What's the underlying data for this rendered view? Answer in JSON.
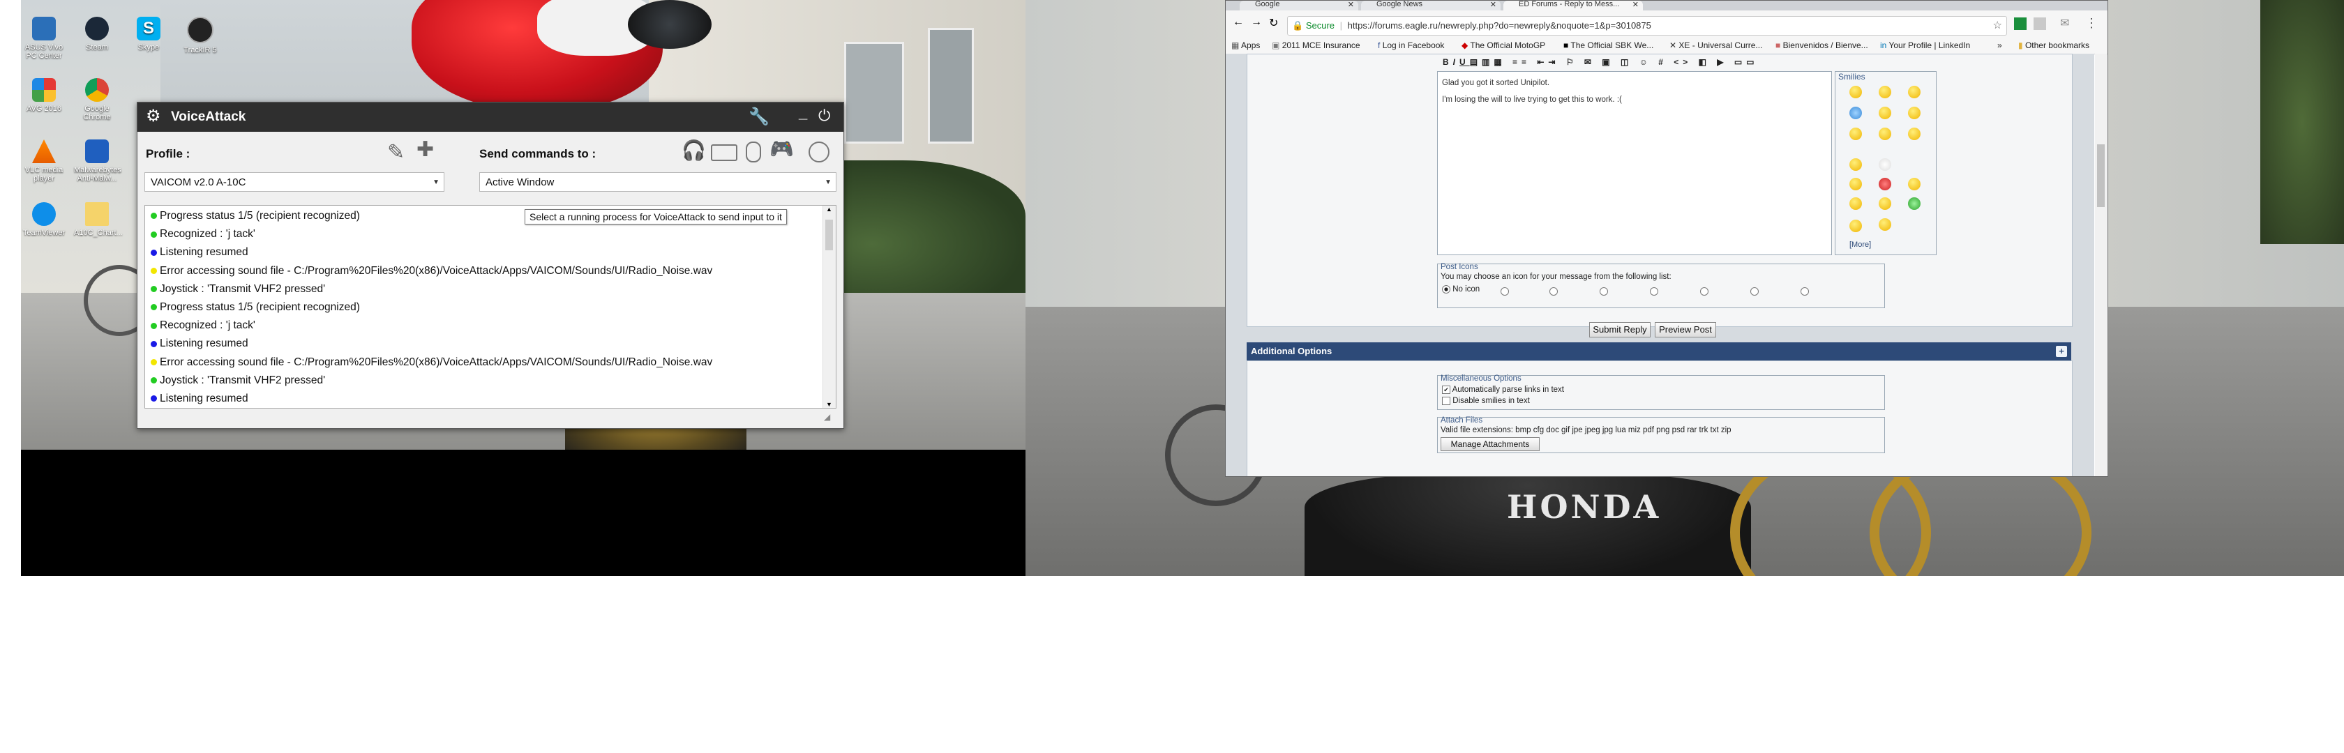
{
  "desktop_icons": [
    {
      "label": "ASUS Vivo PC Center",
      "icon": "asus-icon"
    },
    {
      "label": "Steam",
      "icon": "steam-icon"
    },
    {
      "label": "Skype",
      "icon": "skype-icon"
    },
    {
      "label": "TrackIR 5",
      "icon": "trackir-icon"
    },
    {
      "label": "AVG 2016",
      "icon": "avg-icon"
    },
    {
      "label": "Google Chrome",
      "icon": "chrome-icon"
    },
    {
      "label": "VLC media player",
      "icon": "vlc-icon"
    },
    {
      "label": "Malwarebytes Anti-Malw...",
      "icon": "malwarebytes-icon"
    },
    {
      "label": "TeamViewer",
      "icon": "teamviewer-icon"
    },
    {
      "label": "A10C_Chart...",
      "icon": "file-icon"
    }
  ],
  "voiceattack": {
    "title": "VoiceAttack",
    "profile_label": "Profile :",
    "profile_value": "VAICOM v2.0 A-10C",
    "send_label": "Send commands to :",
    "send_value": "Active Window",
    "tooltip": "Select a running process for VoiceAttack to send input to it",
    "log": [
      {
        "text": "Progress status 1/5 (recipient recognized)",
        "color": "#22cc22"
      },
      {
        "text": "Recognized : 'j tack'",
        "color": "#22cc22"
      },
      {
        "text": "Listening resumed",
        "color": "#1a1ae6"
      },
      {
        "text": "Error accessing sound file - C:/Program%20Files%20(x86)/VoiceAttack/Apps/VAICOM/Sounds/UI/Radio_Noise.wav",
        "color": "#f2e600"
      },
      {
        "text": "Joystick : 'Transmit VHF2 pressed'",
        "color": "#22cc22"
      },
      {
        "text": "Progress status 1/5 (recipient recognized)",
        "color": "#22cc22"
      },
      {
        "text": "Recognized : 'j tack'",
        "color": "#22cc22"
      },
      {
        "text": "Listening resumed",
        "color": "#1a1ae6"
      },
      {
        "text": "Error accessing sound file - C:/Program%20Files%20(x86)/VoiceAttack/Apps/VAICOM/Sounds/UI/Radio_Noise.wav",
        "color": "#f2e600"
      },
      {
        "text": "Joystick : 'Transmit VHF2 pressed'",
        "color": "#22cc22"
      },
      {
        "text": "Listening resumed",
        "color": "#1a1ae6"
      }
    ]
  },
  "chrome": {
    "tabs": [
      {
        "label": "Google"
      },
      {
        "label": "Google News"
      },
      {
        "label": "ED Forums - Reply to Mess..."
      }
    ],
    "secure_label": "Secure",
    "url": "https://forums.eagle.ru/newreply.php?do=newreply&noquote=1&p=3010875",
    "bookmarks": [
      "Apps",
      "2011 MCE Insurance",
      "Log in Facebook",
      "The Official MotoGP",
      "The Official SBK We...",
      "XE - Universal Curre...",
      "Bienvenidos / Bienve...",
      "Your Profile | LinkedIn"
    ],
    "bookmarks_more": "»",
    "other_bookmarks": "Other bookmarks"
  },
  "forum": {
    "editor_line1": "Glad you got it sorted Unipilot.",
    "editor_line2": "I'm losing the will to live trying to get this to work. :(",
    "smilies_title": "Smilies",
    "smilies_more": "[More]",
    "post_icons_title": "Post Icons",
    "post_icons_desc": "You may choose an icon for your message from the following list:",
    "no_icon_label": "No icon",
    "submit_label": "Submit Reply",
    "preview_label": "Preview Post",
    "additional_options": "Additional Options",
    "misc_title": "Miscellaneous Options",
    "misc_opt1": "Automatically parse links in text",
    "misc_opt2": "Disable smilies in text",
    "attach_title": "Attach Files",
    "attach_ext": "Valid file extensions: bmp cfg doc gif jpe jpeg jpg lua miz pdf png psd rar trk txt zip",
    "manage_attach": "Manage Attachments"
  },
  "wallpaper_text": "HONDA",
  "colors": {
    "va_titlebar": "#2f2f2f",
    "forum_header": "#2d4a78",
    "bike_red": "#c8101a"
  }
}
